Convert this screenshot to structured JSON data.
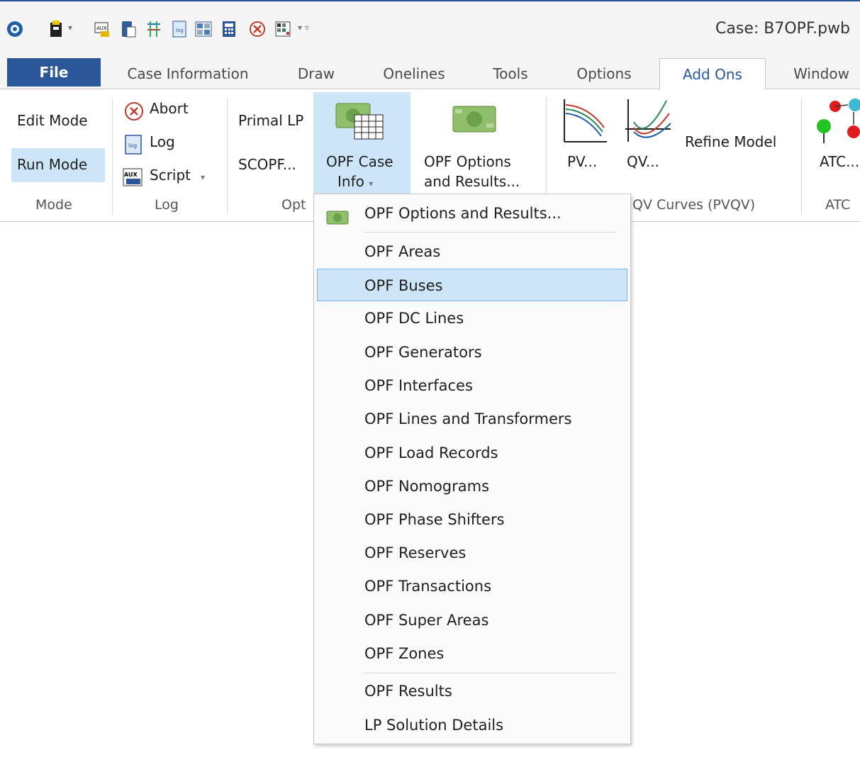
{
  "window": {
    "case_title": "Case: B7OPF.pwb"
  },
  "quick_access": {
    "icons": [
      "app-logo-icon",
      "new-case-icon",
      "aux-icon",
      "database-icon",
      "oneline-icon",
      "log-icon",
      "grid-icon",
      "calculator-icon",
      "abort-icon",
      "matrix-icon"
    ]
  },
  "tabs": [
    {
      "label": "File"
    },
    {
      "label": "Case Information"
    },
    {
      "label": "Draw"
    },
    {
      "label": "Onelines"
    },
    {
      "label": "Tools"
    },
    {
      "label": "Options"
    },
    {
      "label": "Add Ons"
    },
    {
      "label": "Window"
    }
  ],
  "ribbon": {
    "mode": {
      "edit": "Edit Mode",
      "run": "Run Mode",
      "label": "Mode"
    },
    "log": {
      "abort": "Abort",
      "log": "Log",
      "script": "Script",
      "label": "Log"
    },
    "opf": {
      "primal_lp": "Primal LP",
      "scopf": "SCOPF...",
      "case_info_line1": "OPF Case",
      "case_info_line2": "Info",
      "options_line1": "OPF Options",
      "options_line2": "and Results...",
      "label": "Opt"
    },
    "pvqv": {
      "pv": "PV...",
      "qv": "QV...",
      "refine": "Refine Model",
      "label": "QV Curves (PVQV)"
    },
    "atc": {
      "atc": "ATC...",
      "label": "ATC"
    }
  },
  "menu": {
    "items": [
      {
        "label": "OPF Options and Results...",
        "icon": "money-icon"
      },
      {
        "label": "OPF Areas"
      },
      {
        "label": "OPF Buses",
        "highlighted": true
      },
      {
        "label": "OPF DC Lines"
      },
      {
        "label": "OPF Generators"
      },
      {
        "label": "OPF Interfaces"
      },
      {
        "label": "OPF Lines and Transformers"
      },
      {
        "label": "OPF Load Records"
      },
      {
        "label": "OPF Nomograms"
      },
      {
        "label": "OPF Phase Shifters"
      },
      {
        "label": "OPF Reserves"
      },
      {
        "label": "OPF Transactions"
      },
      {
        "label": "OPF Super Areas"
      },
      {
        "label": "OPF Zones"
      },
      {
        "label": "OPF Results"
      },
      {
        "label": "LP Solution Details"
      }
    ]
  },
  "colors": {
    "accent": "#2b579a",
    "selection": "#cde6f7",
    "selection_border": "#7eb4ea"
  }
}
